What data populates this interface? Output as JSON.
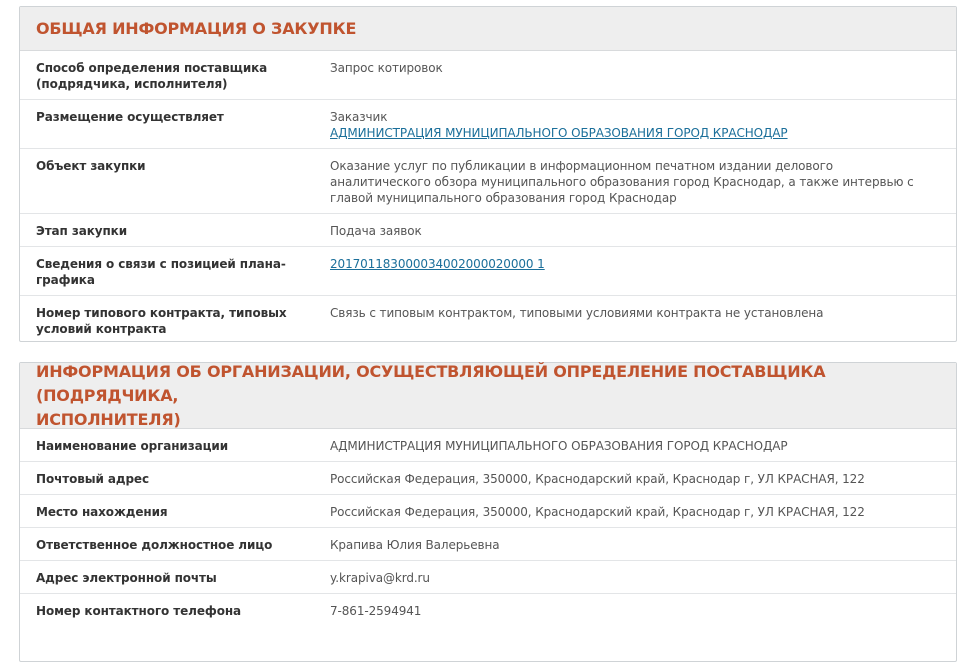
{
  "section1": {
    "title": "ОБЩАЯ ИНФОРМАЦИЯ О ЗАКУПКЕ",
    "rows": [
      {
        "label_line1": "Способ определения поставщика",
        "label_line2": "(подрядчика, исполнителя)",
        "value": "Запрос котировок"
      },
      {
        "label": "Размещение осуществляет",
        "value_line1": "Заказчик",
        "value_link": "АДМИНИСТРАЦИЯ МУНИЦИПАЛЬНОГО ОБРАЗОВАНИЯ ГОРОД КРАСНОДАР"
      },
      {
        "label": "Объект закупки",
        "value_line1": "Оказание услуг по публикации в информационном печатном издании делового",
        "value_line2": "аналитического обзора муниципального образования город Краснодар, а также интервью с",
        "value_line3": "главой муниципального образования город Краснодар"
      },
      {
        "label": "Этап закупки",
        "value": "Подача заявок"
      },
      {
        "label": "Сведения о связи с позицией плана-графика",
        "value_link": "201701183000034002000020000 1"
      },
      {
        "label_line1": "Номер типового контракта, типовых",
        "label_line2": "условий контракта",
        "value": "Связь с типовым контрактом, типовыми условиями контракта не установлена"
      }
    ]
  },
  "section2": {
    "title_line1": "ИНФОРМАЦИЯ ОБ ОРГАНИЗАЦИИ, ОСУЩЕСТВЛЯЮЩЕЙ ОПРЕДЕЛЕНИЕ ПОСТАВЩИКА (ПОДРЯДЧИКА,",
    "title_line2": "ИСПОЛНИТЕЛЯ)",
    "rows": [
      {
        "label": "Наименование организации",
        "value": "АДМИНИСТРАЦИЯ МУНИЦИПАЛЬНОГО ОБРАЗОВАНИЯ ГОРОД КРАСНОДАР"
      },
      {
        "label": "Почтовый адрес",
        "value": "Российская Федерация, 350000, Краснодарский край, Краснодар г, УЛ КРАСНАЯ, 122"
      },
      {
        "label": "Место нахождения",
        "value": "Российская Федерация, 350000, Краснодарский край, Краснодар г, УЛ КРАСНАЯ, 122"
      },
      {
        "label": "Ответственное должностное лицо",
        "value": "Крапива Юлия Валерьевна"
      },
      {
        "label": "Адрес электронной почты",
        "value": "y.krapiva@krd.ru"
      },
      {
        "label": "Номер контактного телефона",
        "value": "7-861-2594941"
      }
    ]
  }
}
